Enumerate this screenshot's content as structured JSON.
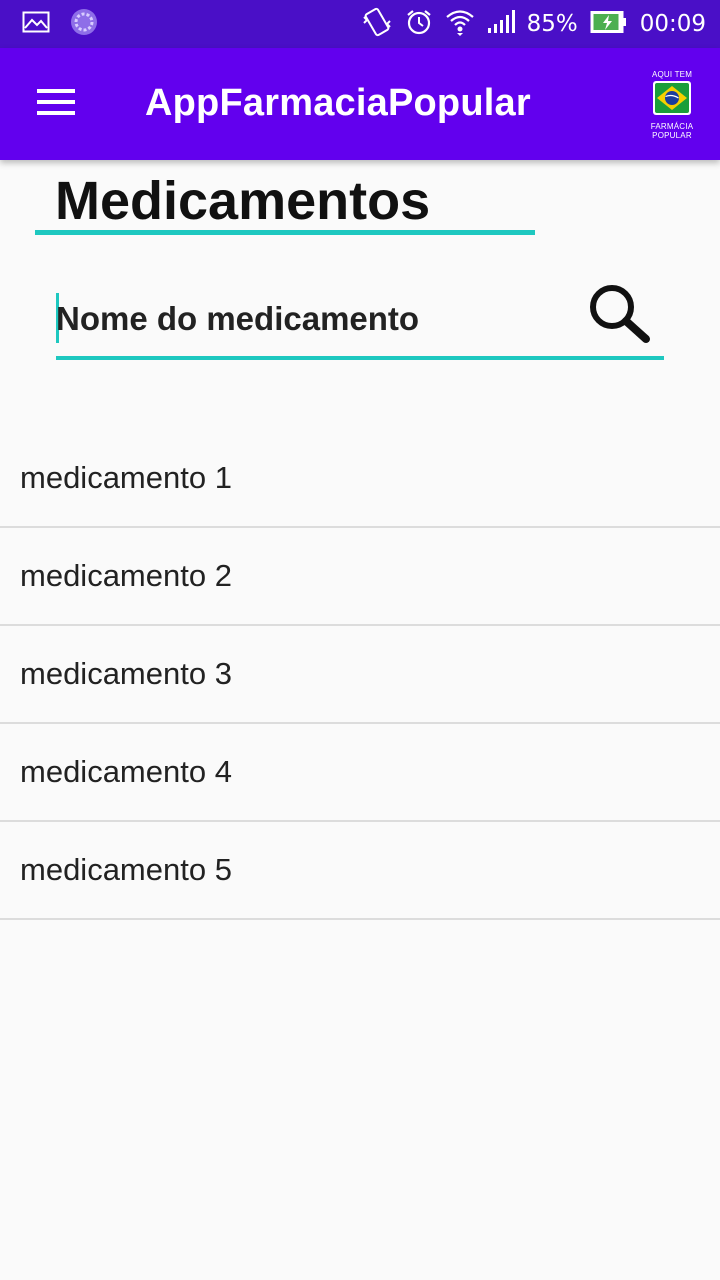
{
  "status_bar": {
    "battery": "85%",
    "time": "00:09",
    "icons": [
      "image-icon",
      "sync-icon",
      "vibrate-icon",
      "alarm-icon",
      "wifi-icon",
      "signal-icon",
      "battery-charging-icon"
    ]
  },
  "app_bar": {
    "title": "AppFarmaciaPopular",
    "menu_icon": "hamburger-menu-icon",
    "logo": {
      "top_text": "AQUI TEM",
      "bottom_text": "FARMÁCIA POPULAR"
    }
  },
  "main": {
    "title": "Medicamentos",
    "search": {
      "placeholder": "Nome do medicamento",
      "value": "",
      "icon": "search-icon"
    },
    "medications": [
      {
        "label": "medicamento 1"
      },
      {
        "label": "medicamento 2"
      },
      {
        "label": "medicamento 3"
      },
      {
        "label": "medicamento 4"
      },
      {
        "label": "medicamento 5"
      }
    ]
  },
  "colors": {
    "status_bar": "#4a0fc7",
    "app_bar": "#6200ee",
    "accent": "#1ec8c0",
    "background": "#fafafa"
  }
}
